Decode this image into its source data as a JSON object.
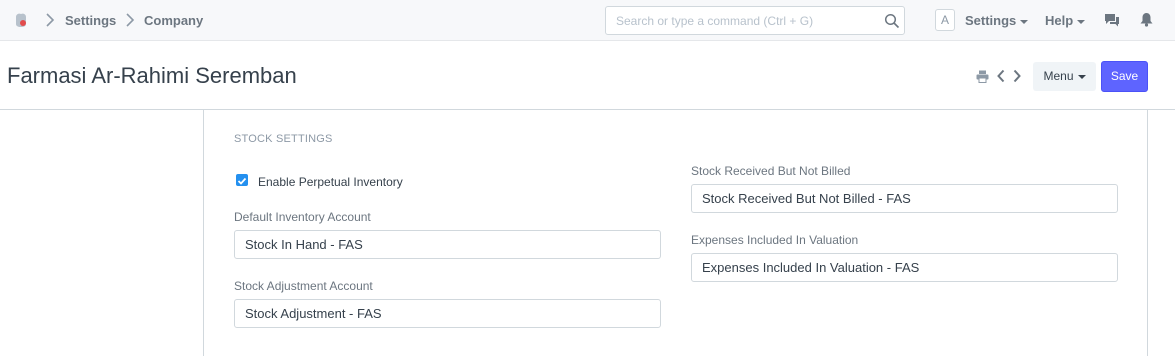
{
  "navbar": {
    "breadcrumbs": [
      "Settings",
      "Company"
    ],
    "search_placeholder": "Search or type a command (Ctrl + G)",
    "avatar_initial": "A",
    "settings_label": "Settings",
    "help_label": "Help"
  },
  "page": {
    "title": "Farmasi Ar-Rahimi Seremban",
    "menu_label": "Menu",
    "save_label": "Save"
  },
  "section": {
    "title": "STOCK SETTINGS",
    "perpetual": {
      "label": "Enable Perpetual Inventory",
      "checked": true
    },
    "fields": [
      {
        "label": "Default Inventory Account",
        "value": "Stock In Hand - FAS"
      },
      {
        "label": "Stock Adjustment Account",
        "value": "Stock Adjustment - FAS"
      },
      {
        "label": "Stock Received But Not Billed",
        "value": "Stock Received But Not Billed - FAS"
      },
      {
        "label": "Expenses Included In Valuation",
        "value": "Expenses Included In Valuation - FAS"
      }
    ]
  },
  "colors": {
    "primary": "#5e64ff",
    "checkbox": "#2490ef",
    "navbar_bg": "#f7f8fa"
  }
}
